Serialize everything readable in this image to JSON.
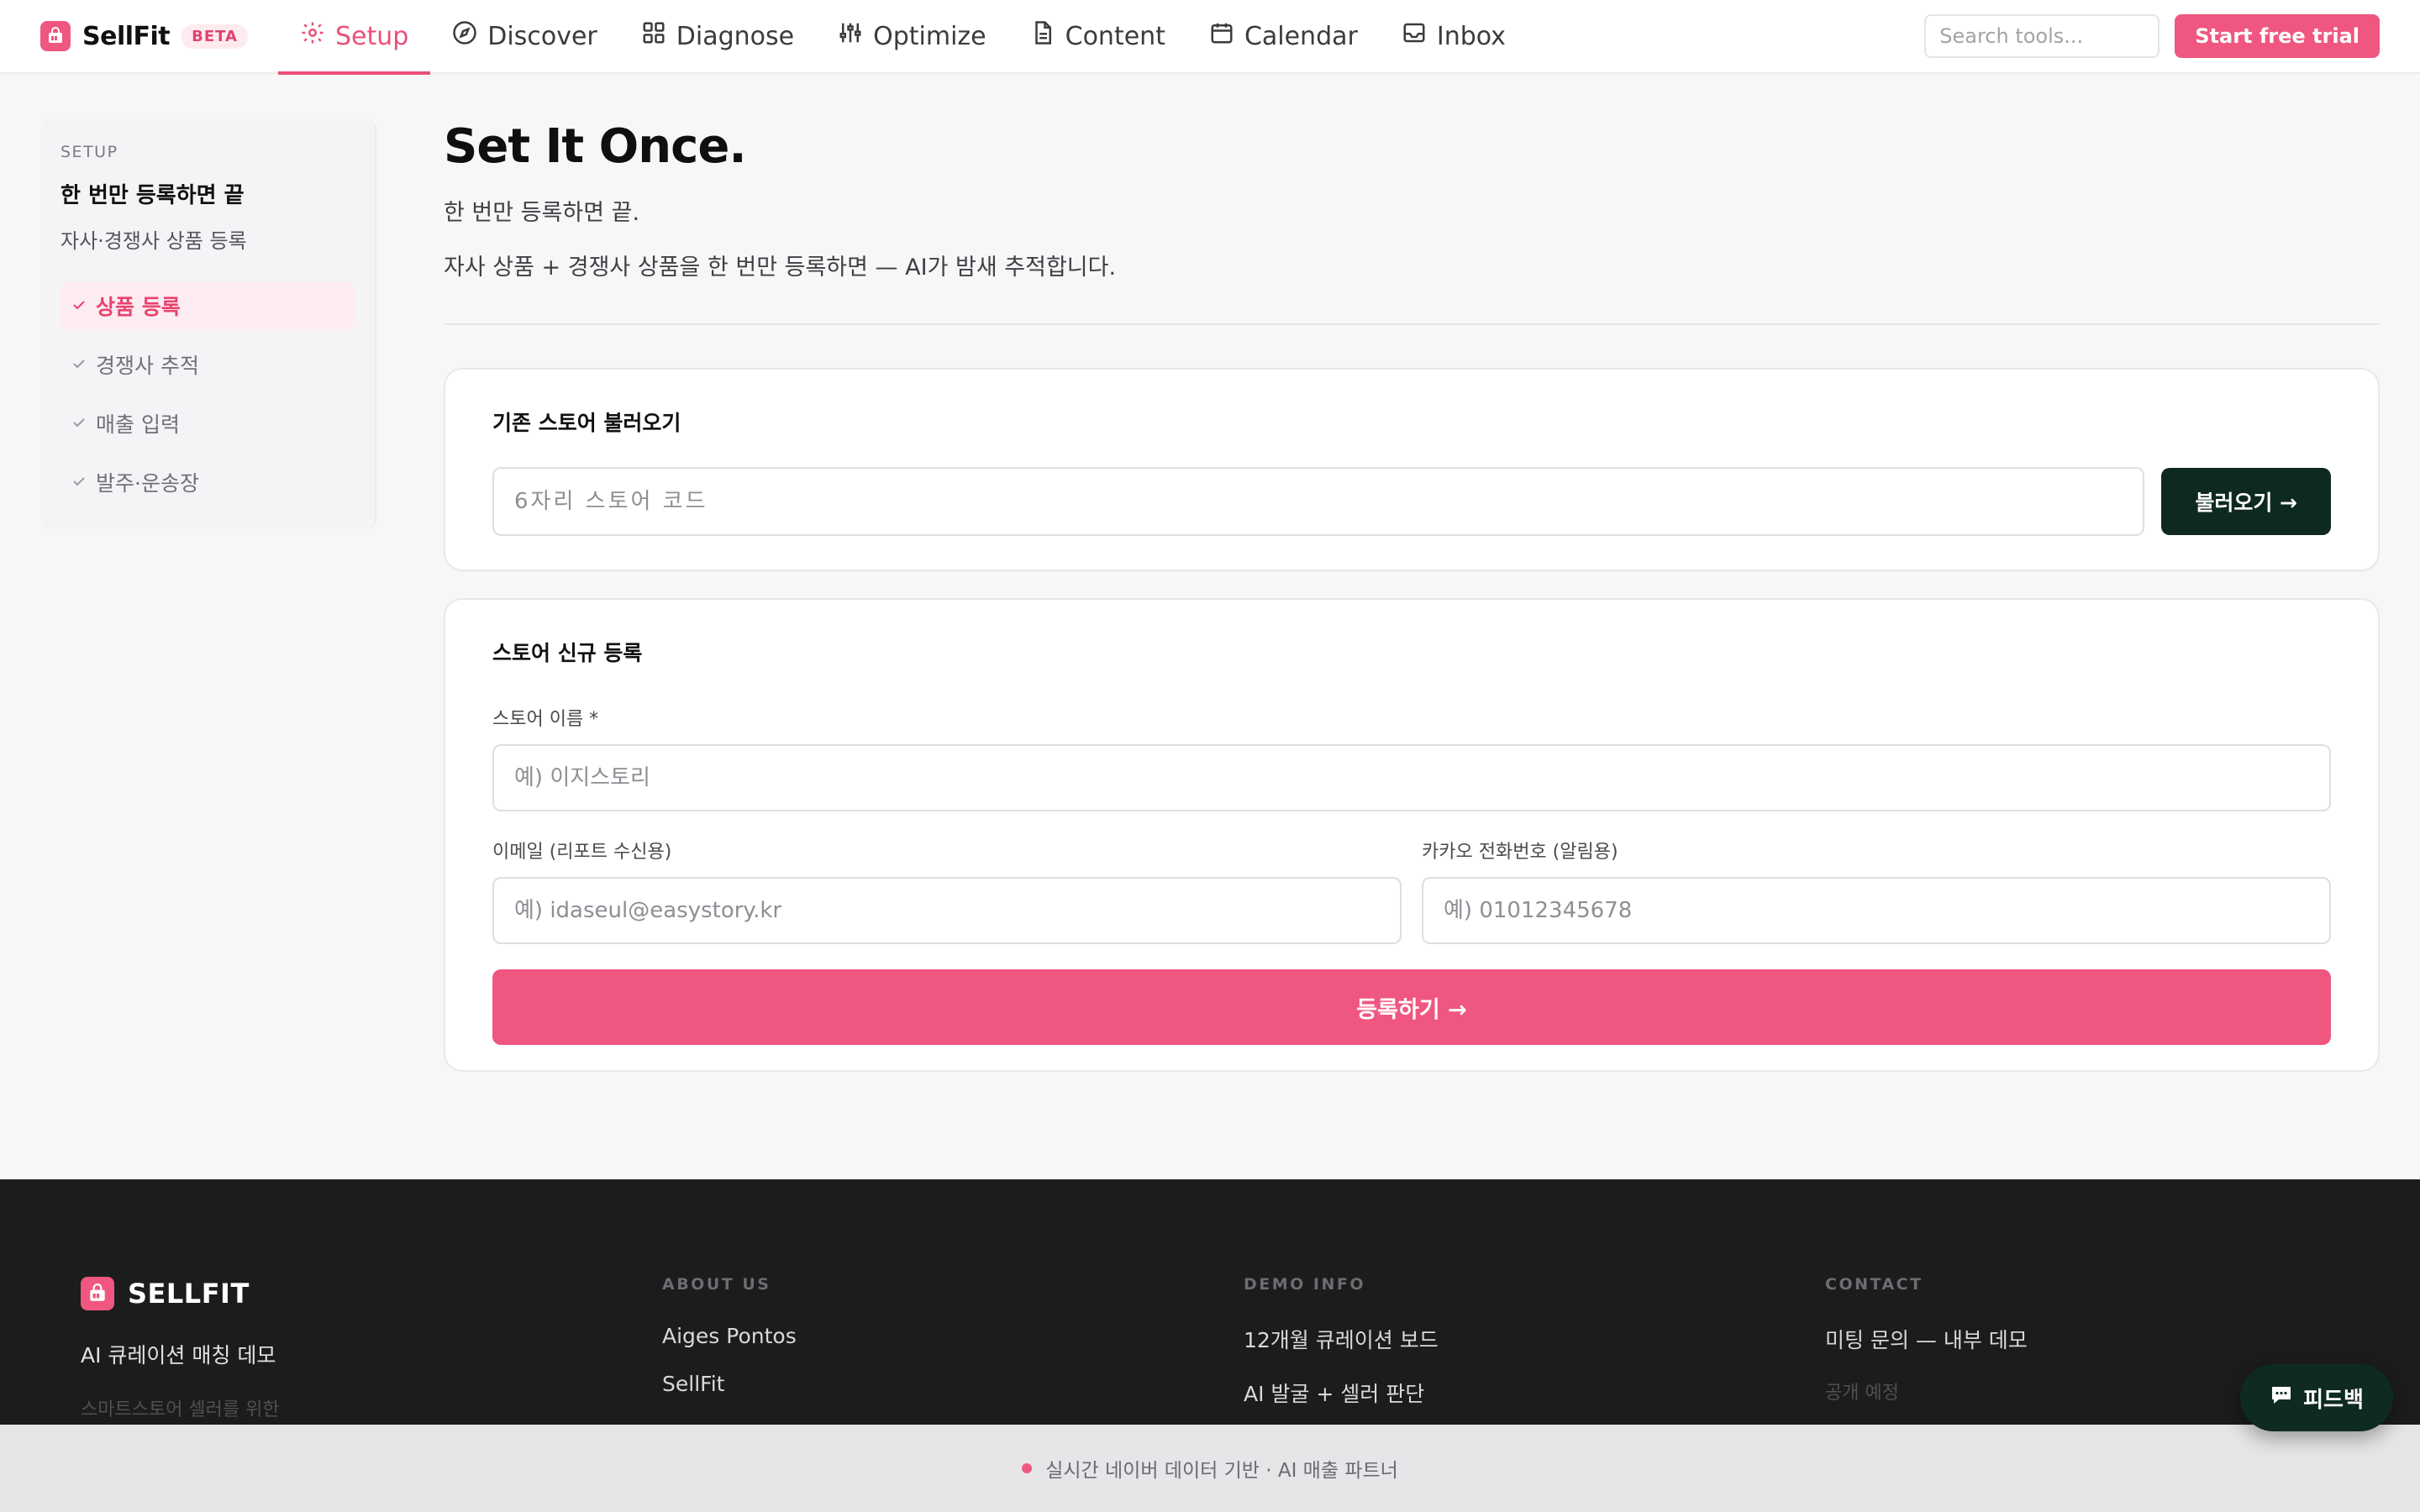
{
  "colors": {
    "accent": "#ef5780",
    "dark_button": "#0e2a20",
    "footer_bg": "#1c1c1d"
  },
  "header": {
    "brand": "SellFit",
    "badge": "BETA",
    "tabs": [
      {
        "label": "Setup",
        "icon": "gear-icon",
        "active": true
      },
      {
        "label": "Discover",
        "icon": "compass-icon"
      },
      {
        "label": "Diagnose",
        "icon": "grid-icon"
      },
      {
        "label": "Optimize",
        "icon": "sliders-icon"
      },
      {
        "label": "Content",
        "icon": "document-icon"
      },
      {
        "label": "Calendar",
        "icon": "calendar-icon"
      },
      {
        "label": "Inbox",
        "icon": "inbox-icon"
      }
    ],
    "search_placeholder": "Search tools...",
    "cta": "Start free trial"
  },
  "sidebar": {
    "overline": "SETUP",
    "title": "한 번만 등록하면 끝",
    "subtitle": "자사·경쟁사 상품 등록",
    "items": [
      {
        "label": "상품 등록",
        "active": true
      },
      {
        "label": "경쟁사 추적"
      },
      {
        "label": "매출 입력"
      },
      {
        "label": "발주·운송장"
      }
    ]
  },
  "main": {
    "title": "Set It Once.",
    "subtitle": "한 번만 등록하면 끝.",
    "description": "자사 상품 + 경쟁사 상품을 한 번만 등록하면 — AI가 밤새 추적합니다.",
    "load_card": {
      "title": "기존 스토어 불러오기",
      "input_placeholder": "6자리 스토어 코드",
      "button": "불러오기 →"
    },
    "register_card": {
      "title": "스토어 신규 등록",
      "store_name_label": "스토어 이름 *",
      "store_name_placeholder": "예) 이지스토리",
      "email_label": "이메일 (리포트 수신용)",
      "email_placeholder": "예) idaseul@easystory.kr",
      "phone_label": "카카오 전화번호 (알림용)",
      "phone_placeholder": "예) 01012345678",
      "submit": "등록하기 →"
    }
  },
  "footer": {
    "brand": "SELLFIT",
    "tagline": "AI 큐레이션 매칭 데모",
    "faded_line": "스마트스토어 셀러를 위한",
    "columns": [
      {
        "heading": "ABOUT US",
        "links": [
          "Aiges Pontos",
          "SellFit"
        ]
      },
      {
        "heading": "DEMO INFO",
        "links": [
          "12개월 큐레이션 보드",
          "AI 발굴 + 셀러 판단"
        ]
      },
      {
        "heading": "CONTACT",
        "links": [
          "미팅 문의 — 내부 데모"
        ],
        "dim": "공개 예정"
      }
    ]
  },
  "ticker": "실시간 네이버 데이터 기반 · AI 매출 파트너",
  "feedback": "피드백"
}
